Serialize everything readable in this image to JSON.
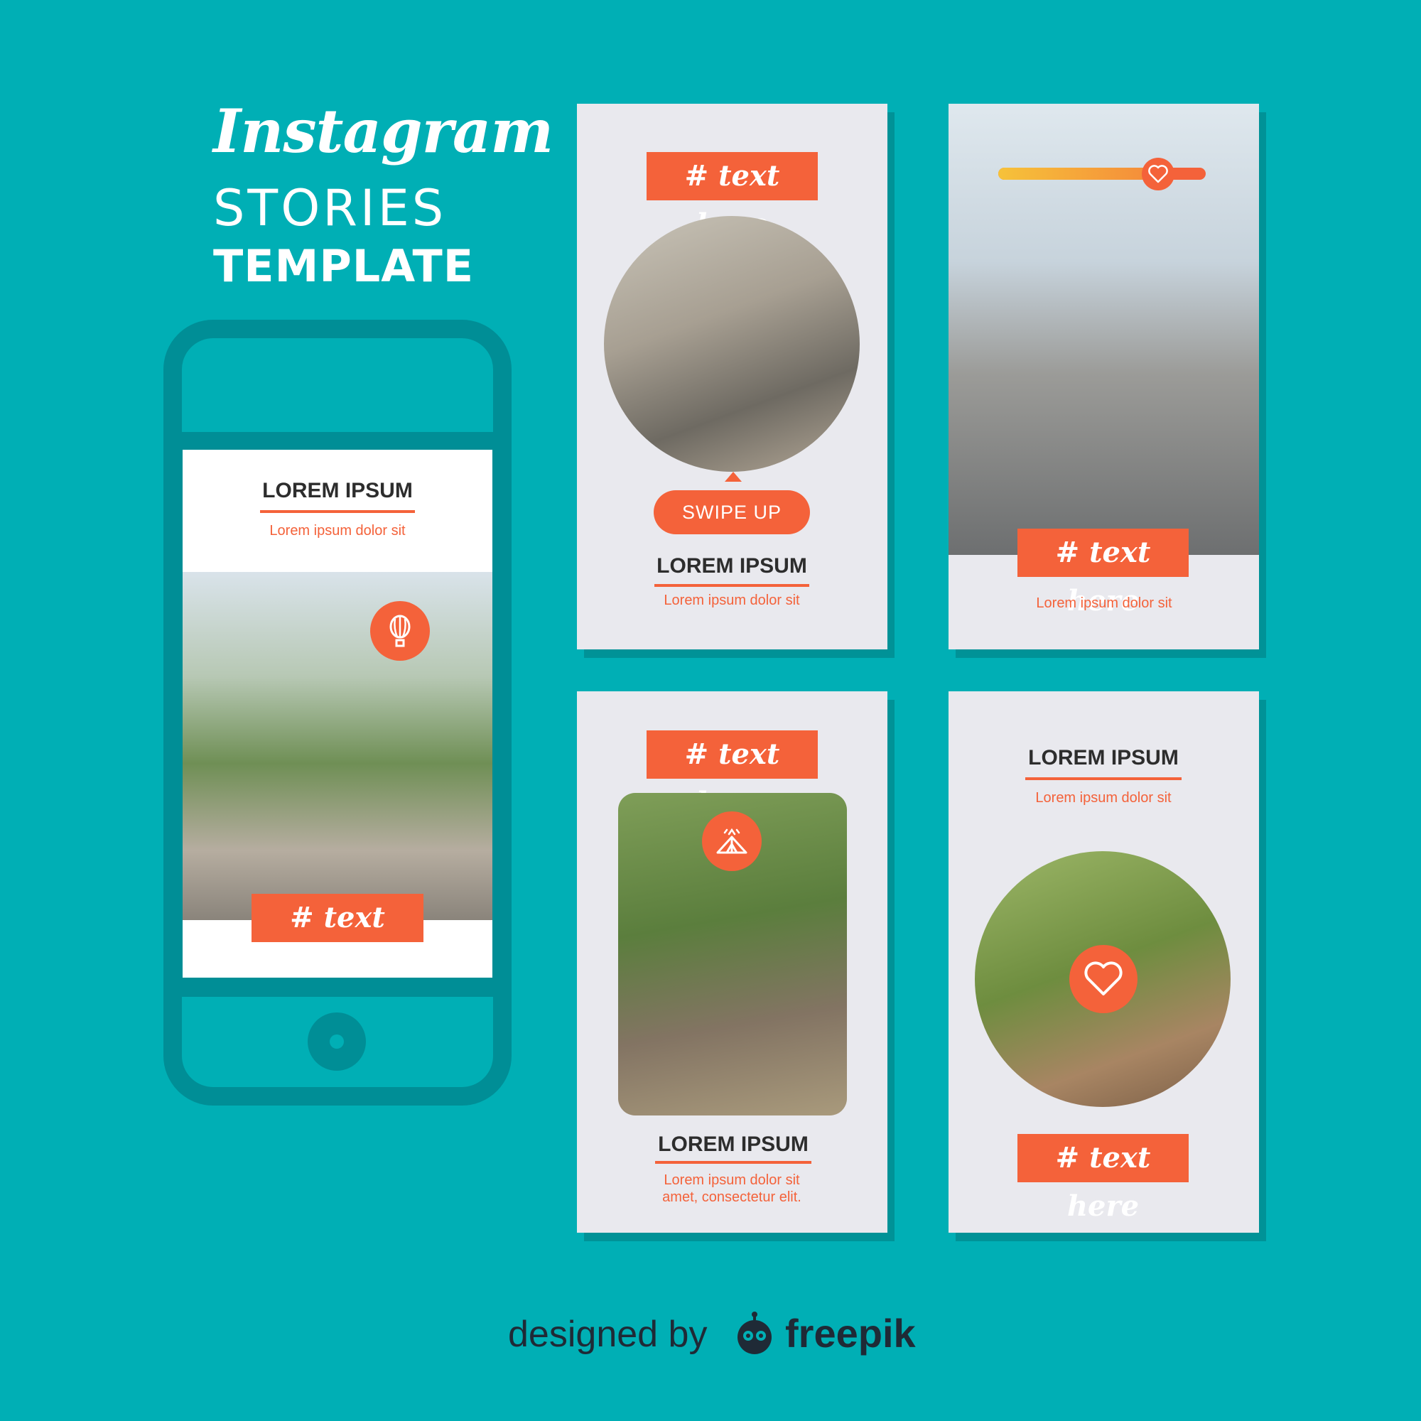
{
  "title": {
    "script": "Instagram",
    "line2": "STORIES",
    "line3": "TEMPLATE"
  },
  "phone": {
    "heading": "LOREM IPSUM",
    "subtext": "Lorem ipsum dolor sit",
    "tag": "# text here",
    "icon": "hot-air-balloon-icon"
  },
  "card1": {
    "tag": "# text here",
    "button": "SWIPE UP",
    "heading": "LOREM IPSUM",
    "subtext": "Lorem ipsum dolor sit"
  },
  "card2": {
    "tag": "# text here",
    "subtext": "Lorem ipsum dolor sit",
    "slider_icon": "heart-icon",
    "slider_level": 0.77
  },
  "card3": {
    "tag": "# text here",
    "heading": "LOREM IPSUM",
    "subtext_line1": "Lorem ipsum dolor sit",
    "subtext_line2": "amet, consectetur elit.",
    "icon": "camp-tent-icon"
  },
  "card4": {
    "heading": "LOREM IPSUM",
    "subtext": "Lorem ipsum dolor sit",
    "tag": "# text here",
    "icon": "heart-icon"
  },
  "footer": {
    "designed_by": "designed by",
    "brand": "freepik"
  },
  "colors": {
    "background": "#00afb5",
    "accent": "#f4623a",
    "phone": "#008e96",
    "card": "#e9e9ee"
  }
}
